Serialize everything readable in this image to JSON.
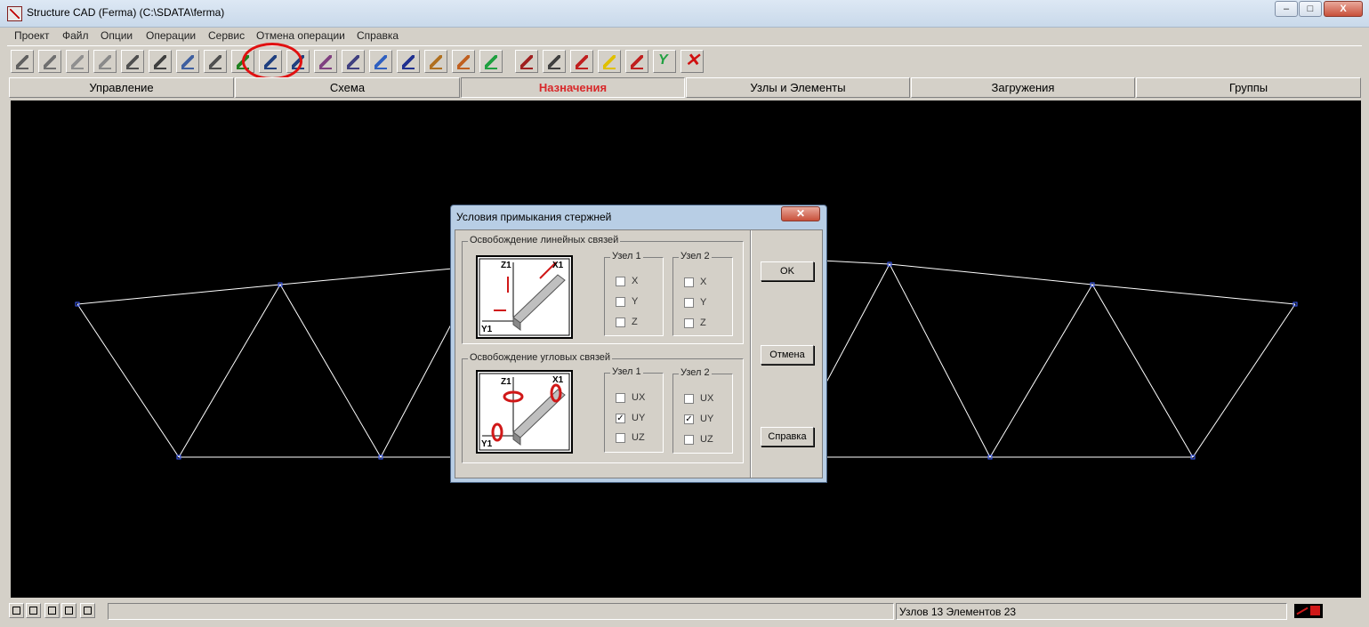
{
  "window": {
    "title": "Structure CAD (Ferma) (C:\\SDATA\\ferma)",
    "controls": {
      "minimize": "–",
      "maximize": "□",
      "close": "X"
    }
  },
  "menu": [
    "Проект",
    "Файл",
    "Опции",
    "Операции",
    "Сервис",
    "Отмена операции",
    "Справка"
  ],
  "toolbar": {
    "icons": [
      "pencil-r-icon",
      "plate-r-icon",
      "solid-r-icon",
      "slab-r-icon",
      "block-r-icon",
      "layers-icon",
      "support-icon",
      "axes-icon",
      "plus-minus-icon",
      "hinge-insert-icon",
      "hinge-remove-icon",
      "wand-icon",
      "edit-icon",
      "nodes-icon",
      "x-axis-icon",
      "z-axis-icon",
      "color-cube-icon",
      "green-cube-icon",
      "table-arrow-icon",
      "table-r-icon",
      "curve-icon",
      "color-scale-icon",
      "rz-icon",
      "check-icon",
      "delete-icon"
    ],
    "highlighted": "hinge-tools"
  },
  "tabs": [
    {
      "label": "Управление",
      "active": false
    },
    {
      "label": "Схема",
      "active": false
    },
    {
      "label": "Назначения",
      "active": true
    },
    {
      "label": "Узлы и Элементы",
      "active": false
    },
    {
      "label": "Загружения",
      "active": false
    },
    {
      "label": "Группы",
      "active": false
    }
  ],
  "colors": {
    "canvas": "#000000",
    "truss": "#ffffff",
    "node": "#4060ff",
    "active_tab": "#d8282a",
    "highlight": "#e01010"
  },
  "dialog": {
    "title": "Условия примыкания стержней",
    "close": "✕",
    "linear": {
      "legend": "Освобождение линейных связей",
      "pic_labels": {
        "z": "Z1",
        "x": "X1",
        "y": "Y1"
      },
      "node1": {
        "legend": "Узел 1",
        "items": [
          {
            "label": "X",
            "checked": false
          },
          {
            "label": "Y",
            "checked": false
          },
          {
            "label": "Z",
            "checked": false
          }
        ]
      },
      "node2": {
        "legend": "Узел 2",
        "items": [
          {
            "label": "X",
            "checked": false
          },
          {
            "label": "Y",
            "checked": false
          },
          {
            "label": "Z",
            "checked": false
          }
        ]
      }
    },
    "angular": {
      "legend": "Освобождение угловых связей",
      "pic_labels": {
        "z": "Z1",
        "x": "X1",
        "y": "Y1"
      },
      "node1": {
        "legend": "Узел 1",
        "items": [
          {
            "label": "UX",
            "checked": false
          },
          {
            "label": "UY",
            "checked": true
          },
          {
            "label": "UZ",
            "checked": false
          }
        ]
      },
      "node2": {
        "legend": "Узел 2",
        "items": [
          {
            "label": "UX",
            "checked": false
          },
          {
            "label": "UY",
            "checked": true
          },
          {
            "label": "UZ",
            "checked": false
          }
        ]
      }
    },
    "buttons": {
      "ok": "OK",
      "cancel": "Отмена",
      "help": "Справка"
    }
  },
  "status": {
    "info": "Узлов 13 Элементов 23",
    "view_buttons": [
      "view-front-icon",
      "view-iso-icon",
      "view-plan-icon",
      "view-side-icon",
      "view-grid-icon"
    ]
  }
}
